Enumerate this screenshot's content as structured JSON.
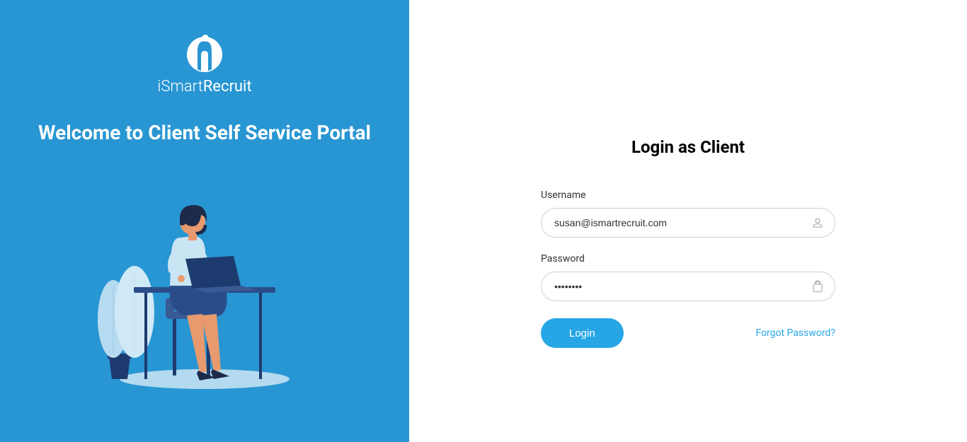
{
  "brand": {
    "name_prefix": "iSmart",
    "name_suffix": "Recruit"
  },
  "left": {
    "welcome_heading": "Welcome to Client Self Service Portal"
  },
  "login": {
    "heading": "Login as Client",
    "username_label": "Username",
    "username_value": "susan@ismartrecruit.com",
    "password_label": "Password",
    "password_value": "••••••••",
    "login_button": "Login",
    "forgot_password": "Forgot Password?"
  }
}
